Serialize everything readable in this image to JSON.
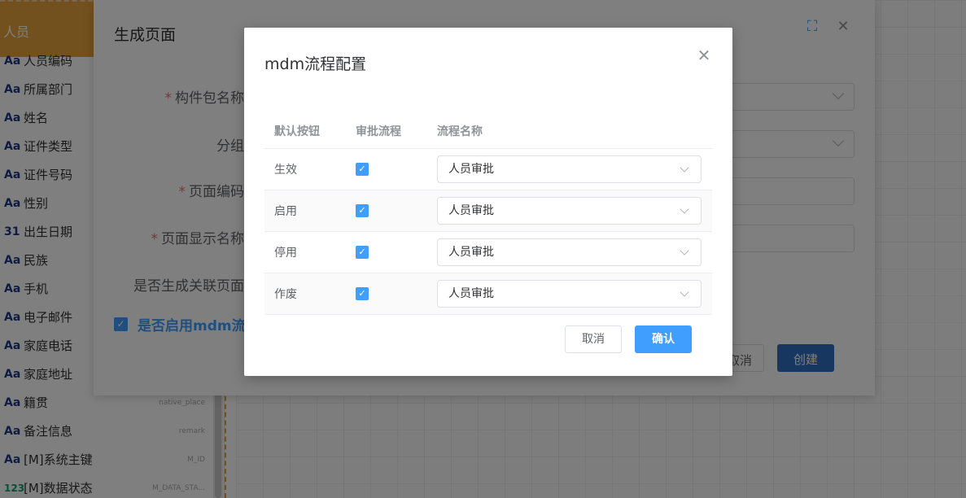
{
  "field_list": {
    "group_label": "‌‌人员",
    "fields": [
      {
        "icon": "Aa",
        "label": "人员编码",
        "key": ""
      },
      {
        "icon": "Aa",
        "label": "所属部门",
        "key": ""
      },
      {
        "icon": "Aa",
        "label": "姓名",
        "key": ""
      },
      {
        "icon": "Aa",
        "label": "证件类型",
        "key": ""
      },
      {
        "icon": "Aa",
        "label": "证件号码",
        "key": ""
      },
      {
        "icon": "Aa",
        "label": "性别",
        "key": ""
      },
      {
        "icon": "31",
        "label": "出生日期",
        "key": ""
      },
      {
        "icon": "Aa",
        "label": "民族",
        "key": ""
      },
      {
        "icon": "Aa",
        "label": "手机",
        "key": ""
      },
      {
        "icon": "Aa",
        "label": "电子邮件",
        "key": ""
      },
      {
        "icon": "Aa",
        "label": "家庭电话",
        "key": ""
      },
      {
        "icon": "Aa",
        "label": "家庭地址",
        "key": ""
      },
      {
        "icon": "Aa",
        "label": "籍贯",
        "key": "native_place"
      },
      {
        "icon": "Aa",
        "label": "备注信息",
        "key": "remark"
      },
      {
        "icon": "Aa",
        "label": "[M]系统主键",
        "key": "M_ID"
      },
      {
        "icon": "123",
        "label": "[M]数据状态",
        "key": "M_DATA_STA..."
      }
    ]
  },
  "bg_dialog": {
    "title": "生成页面",
    "labels": {
      "package_name": "构件包名称",
      "group": "分组",
      "page_code": "页面编码",
      "page_display_name": "页面显示名称",
      "gen_related": "是否生成关联页面"
    },
    "mdm_check_label": "是否启用mdm流",
    "cancel_label": "取消",
    "create_label": "创建"
  },
  "modal": {
    "title": "mdm流程配置",
    "columns": [
      "默认按钮",
      "审批流程",
      "流程名称"
    ],
    "rows": [
      {
        "button": "生效",
        "checked": true,
        "process": "人员审批"
      },
      {
        "button": "启用",
        "checked": true,
        "process": "人员审批"
      },
      {
        "button": "停用",
        "checked": true,
        "process": "人员审批"
      },
      {
        "button": "作废",
        "checked": true,
        "process": "人员审批"
      }
    ],
    "cancel_label": "取消",
    "confirm_label": "确认"
  },
  "colors": {
    "accent": "#409eff",
    "group_header": "#e6a23c",
    "required": "#f56c6c"
  }
}
